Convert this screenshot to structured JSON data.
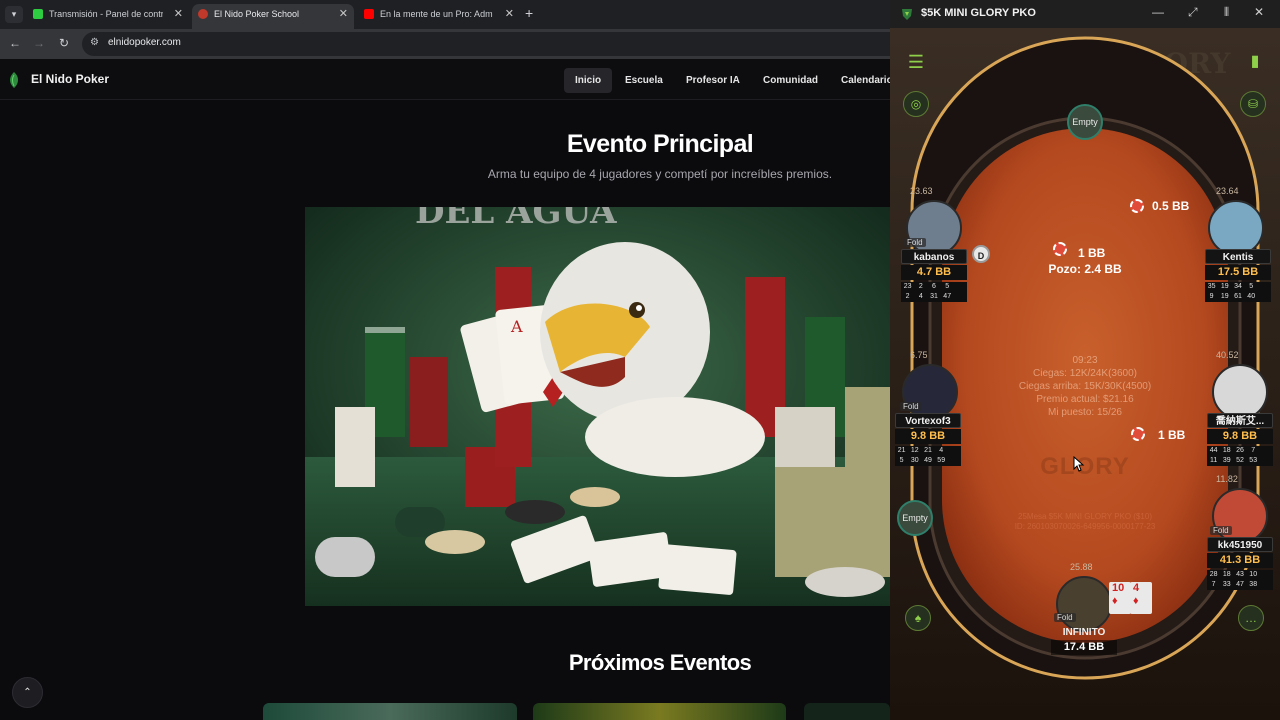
{
  "browser": {
    "tabs": [
      {
        "title": "Transmisión - Panel de control",
        "color": "#2ecc40"
      },
      {
        "title": "El Nido Poker School",
        "color": "#c0392b"
      },
      {
        "title": "En la mente de un Pro: Adm",
        "color": "#ff0000"
      }
    ],
    "url": "elnidopoker.com"
  },
  "site": {
    "brand": "El Nido Poker",
    "nav": [
      "Inicio",
      "Escuela",
      "Profesor IA",
      "Comunidad",
      "Calendario"
    ],
    "hero_title": "Evento Principal",
    "hero_subtitle": "Arma tu equipo de 4 jugadores y competí por increíbles premios.",
    "events_title": "Próximos Eventos"
  },
  "poker": {
    "window_title": "$5K MINI GLORY PKO",
    "empty_label": "Empty",
    "players": [
      {
        "name": "kabanos",
        "stack": "4.7 BB",
        "timer": "23.63",
        "fold": "Fold",
        "stats": [
          "23",
          "2",
          "6",
          "5",
          "",
          "2",
          "4",
          "31",
          "47",
          ""
        ]
      },
      {
        "name": "Kentis",
        "stack": "17.5 BB",
        "timer": "23.64",
        "fold": "",
        "stats": [
          "35",
          "19",
          "34",
          "5",
          "",
          "9",
          "19",
          "61",
          "40",
          ""
        ]
      },
      {
        "name": "Vortexof3",
        "stack": "9.8 BB",
        "timer": "6.75",
        "fold": "Fold",
        "stats": [
          "21",
          "12",
          "21",
          "4",
          "",
          "5",
          "30",
          "49",
          "59",
          ""
        ]
      },
      {
        "name": "喬納斯艾...",
        "stack": "9.8 BB",
        "timer": "40.52",
        "fold": "",
        "stats": [
          "44",
          "18",
          "26",
          "7",
          "",
          "11",
          "39",
          "52",
          "53",
          ""
        ]
      },
      {
        "name": "kk451950",
        "stack": "41.3 BB",
        "timer": "11.82",
        "fold": "Fold",
        "stats": [
          "28",
          "18",
          "43",
          "10",
          "",
          "7",
          "33",
          "47",
          "38",
          ""
        ]
      },
      {
        "name": "INFINITO",
        "stack": "17.4 BB",
        "timer": "25.88",
        "fold": "Fold",
        "stats": []
      }
    ],
    "bets": {
      "kentis": "0.5 BB",
      "kabanos_center": "1 BB",
      "right": "1 BB"
    },
    "dealer": "D",
    "pot": "Pozo: 2.4 BB",
    "info": [
      "09:23",
      "Ciegas: 12K/24K(3600)",
      "Ciegas arriba: 15K/30K(4500)",
      "Premio actual: $21.16",
      "Mi puesto: 15/26"
    ],
    "watermark": "GLORY",
    "table_name": "25Mesa $5K MINI GLORY PKO ($10)",
    "table_id": "ID: 260103070026-649956-0000177-23",
    "hero_cards": [
      "10",
      "4"
    ],
    "colors": {
      "accent": "#8ed04a",
      "stack": "#ffbe4d",
      "felt": "#c65a28"
    }
  }
}
